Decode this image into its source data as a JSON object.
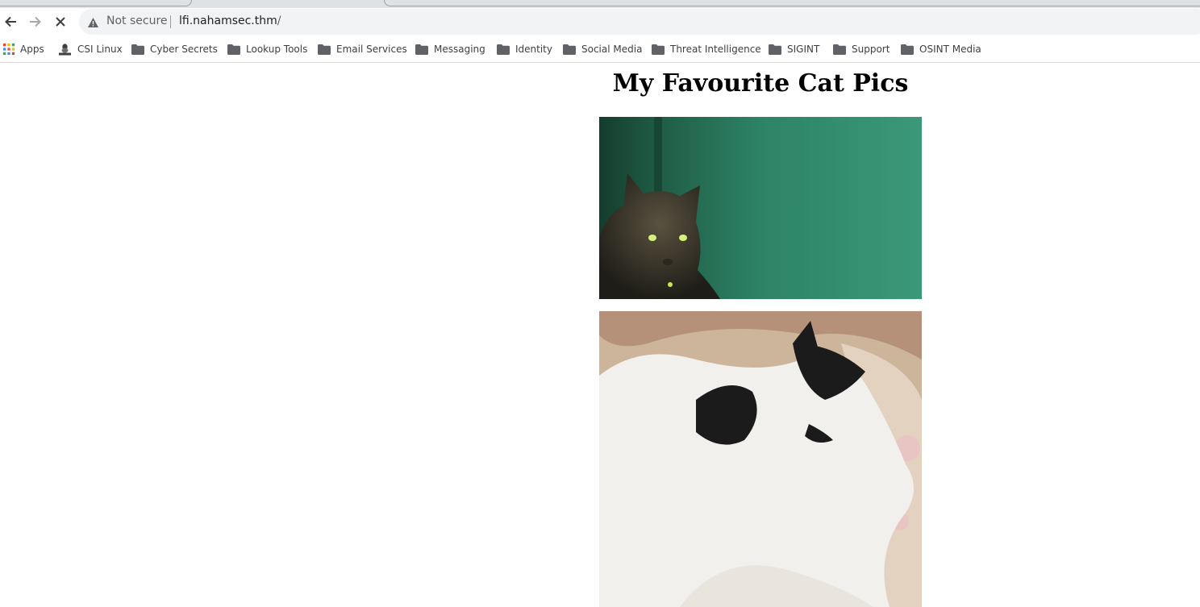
{
  "toolbar": {
    "security_label": "Not secure",
    "url_host": "lfi.nahamsec.thm",
    "url_path": "/"
  },
  "bookmarks": [
    {
      "label": "Apps",
      "icon": "apps-grid-icon"
    },
    {
      "label": "CSI Linux",
      "icon": "linux-icon"
    },
    {
      "label": "Cyber Secrets",
      "icon": "folder-icon"
    },
    {
      "label": "Lookup Tools",
      "icon": "folder-icon"
    },
    {
      "label": "Email Services",
      "icon": "folder-icon"
    },
    {
      "label": "Messaging",
      "icon": "folder-icon"
    },
    {
      "label": "Identity",
      "icon": "folder-icon"
    },
    {
      "label": "Social Media",
      "icon": "folder-icon"
    },
    {
      "label": "Threat Intelligence",
      "icon": "folder-icon"
    },
    {
      "label": "SIGINT",
      "icon": "folder-icon"
    },
    {
      "label": "Support",
      "icon": "folder-icon"
    },
    {
      "label": "OSINT Media",
      "icon": "folder-icon"
    }
  ],
  "page": {
    "title": "My Favourite Cat Pics"
  },
  "colors": {
    "chrome_bg": "#dee1e6",
    "omnibox_bg": "#f1f3f4",
    "folder": "#5f6368"
  }
}
